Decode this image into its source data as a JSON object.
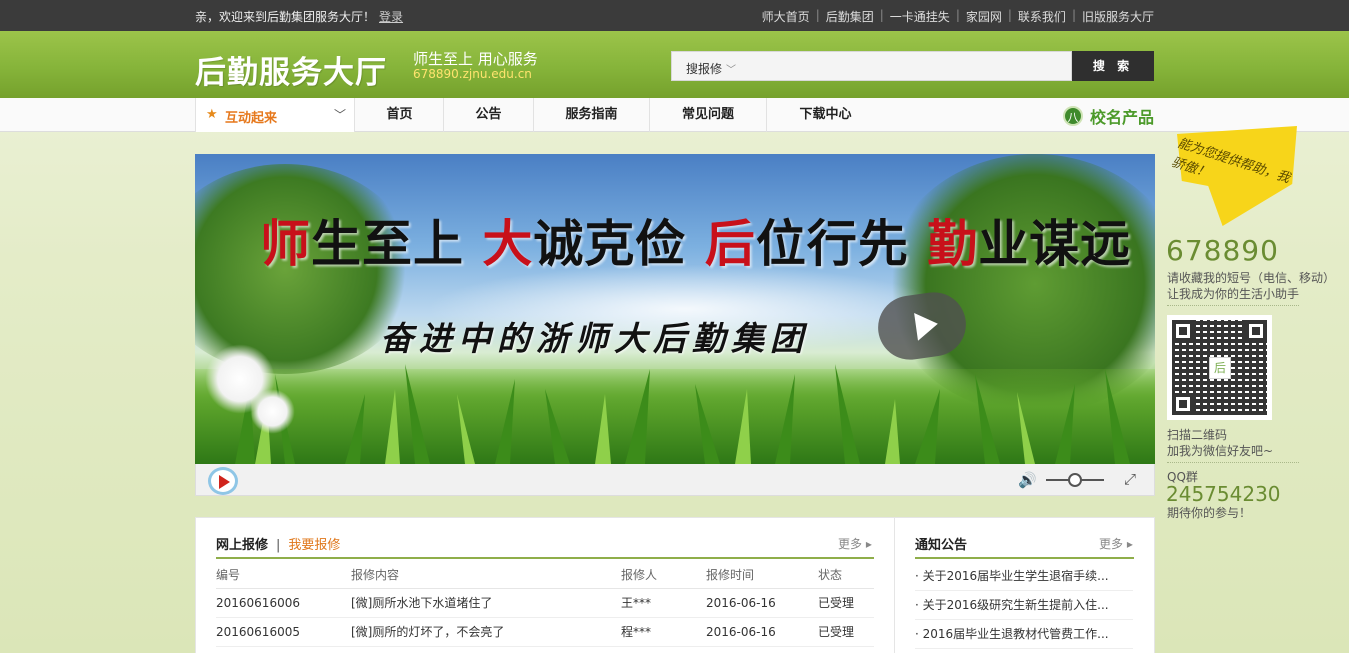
{
  "topbar": {
    "welcome": "亲，欢迎来到后勤集团服务大厅！",
    "login": "登录",
    "links": [
      "师大首页",
      "后勤集团",
      "一卡通挂失",
      "家园网",
      "联系我们",
      "旧版服务大厅"
    ],
    "separator": "|"
  },
  "header": {
    "logo": "后勤服务大厅",
    "slogan": "师生至上 用心服务",
    "url": "678890.zjnu.edu.cn",
    "search": {
      "type_label": "搜报修",
      "chevron": "﹀",
      "placeholder": "",
      "button": "搜 索"
    }
  },
  "nav": {
    "dropdown_label": "互动起来",
    "star": "★",
    "chevron": "﹀",
    "items": [
      "首页",
      "公告",
      "服务指南",
      "常见问题",
      "下载中心"
    ],
    "brand_icon": "八",
    "brand_text": "校名产品"
  },
  "banner": {
    "slogan_parts": [
      {
        "red": "师",
        "black": "生至上 "
      },
      {
        "red": "大",
        "black": "诚克俭 "
      },
      {
        "red": "后",
        "black": "位行先 "
      },
      {
        "red": "勤",
        "black": "业谋远"
      }
    ],
    "subtitle": "奋进中的浙师大后勤集团"
  },
  "player": {
    "volume_icon": "🔊",
    "fullscreen_icon": "⤢",
    "volume_level": 0.5
  },
  "sidebar": {
    "note": "能为您提供帮助，我骄傲！",
    "number": "678890",
    "number_desc1": "请收藏我的短号（电信、移动）",
    "number_desc2": "让我成为你的生活小助手",
    "qr_logo": "后",
    "qr_desc1": "扫描二维码",
    "qr_desc2": "加我为微信好友吧~",
    "qq_label": "QQ群",
    "qq_number": "245754230",
    "qq_desc": "期待你的参与！"
  },
  "repair_panel": {
    "title": "网上报修",
    "separator": "|",
    "link": "我要报修",
    "more": "更多 ▸",
    "columns": [
      "编号",
      "报修内容",
      "报修人",
      "报修时间",
      "状态"
    ],
    "rows": [
      [
        "20160616006",
        "[微]厕所水池下水道堵住了",
        "王***",
        "2016-06-16",
        "已受理"
      ],
      [
        "20160616005",
        "[微]厕所的灯坏了，不会亮了",
        "程***",
        "2016-06-16",
        "已受理"
      ]
    ]
  },
  "notice_panel": {
    "title": "通知公告",
    "more": "更多 ▸",
    "items": [
      "· 关于2016届毕业生学生退宿手续...",
      "· 关于2016级研究生新生提前入住...",
      "· 2016届毕业生退教材代管费工作..."
    ]
  },
  "colors": {
    "accent_green": "#86b43a",
    "orange": "#e6781c",
    "banner_red": "#c8101a"
  }
}
